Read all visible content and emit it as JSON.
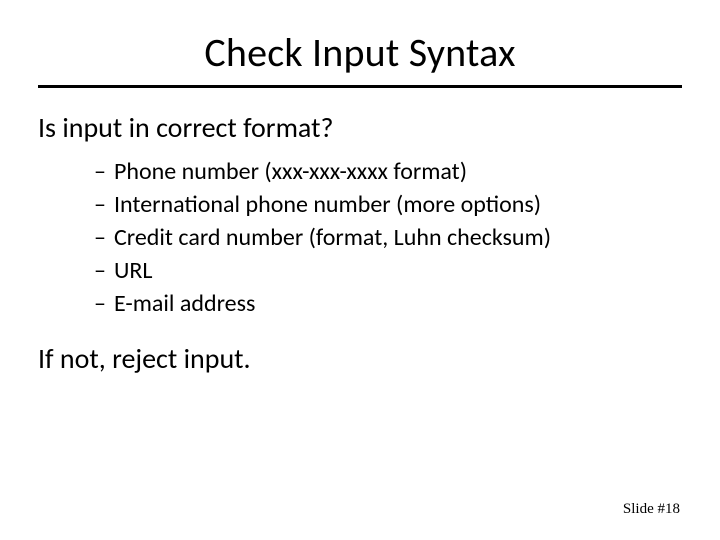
{
  "title": "Check Input Syntax",
  "question": "Is input in correct format?",
  "bullets": [
    "Phone number (xxx-xxx-xxxx format)",
    "International phone number (more options)",
    "Credit card number (format, Luhn checksum)",
    "URL",
    "E-mail address"
  ],
  "closing": "If not, reject input.",
  "footer": "Slide #18"
}
